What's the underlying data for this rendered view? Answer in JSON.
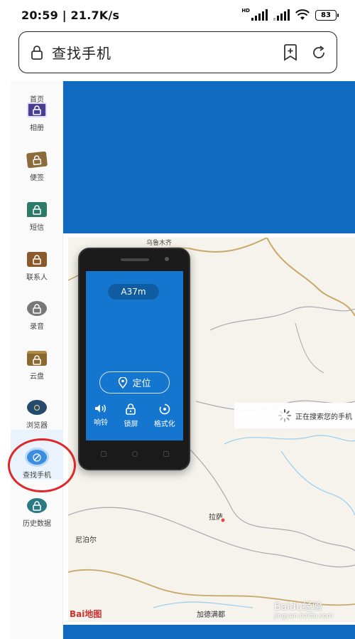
{
  "status": {
    "time": "20:59",
    "speed": "21.7K/s",
    "hd_label": "HD",
    "battery": "83"
  },
  "address_bar": {
    "title": "查找手机"
  },
  "sidebar": {
    "items": [
      {
        "label": "首页",
        "icon": "home-icon",
        "color": "#6a5aa8"
      },
      {
        "label": "相册",
        "icon": "album-lock-icon",
        "color": "#4a3f8f"
      },
      {
        "label": "便签",
        "icon": "note-lock-icon",
        "color": "#8c6a3a"
      },
      {
        "label": "短信",
        "icon": "sms-lock-icon",
        "color": "#2e7a68"
      },
      {
        "label": "联系人",
        "icon": "contacts-lock-icon",
        "color": "#8a5a2c"
      },
      {
        "label": "录音",
        "icon": "recording-lock-icon",
        "color": "#777777"
      },
      {
        "label": "云盘",
        "icon": "cloud-lock-icon",
        "color": "#8a6a2e"
      },
      {
        "label": "浏览器",
        "icon": "browser-lock-icon",
        "color": "#244a6e"
      },
      {
        "label": "查找手机",
        "icon": "find-phone-icon",
        "color": "#3b8de0"
      },
      {
        "label": "历史数据",
        "icon": "history-lock-icon",
        "color": "#2a7a86"
      }
    ]
  },
  "phone_panel": {
    "model": "A37m",
    "locate_label": "定位",
    "actions": [
      {
        "label": "响铃",
        "icon": "speaker-icon"
      },
      {
        "label": "锁屏",
        "icon": "lock-icon"
      },
      {
        "label": "格式化",
        "icon": "format-icon"
      }
    ]
  },
  "map": {
    "searching_text": "正在搜索您的手机",
    "labels": {
      "lhasa": "拉萨",
      "nepal": "尼泊尔",
      "kathmandu": "加德满都",
      "top_label": "乌鲁木齐"
    },
    "logo": "Bai地图",
    "watermark": "Baidu经验",
    "watermark_url": "jingyan.baidu.com"
  },
  "colors": {
    "accent_blue": "#0f6ac0",
    "phone_screen": "#1576d0",
    "highlight_red": "#e0262a"
  }
}
